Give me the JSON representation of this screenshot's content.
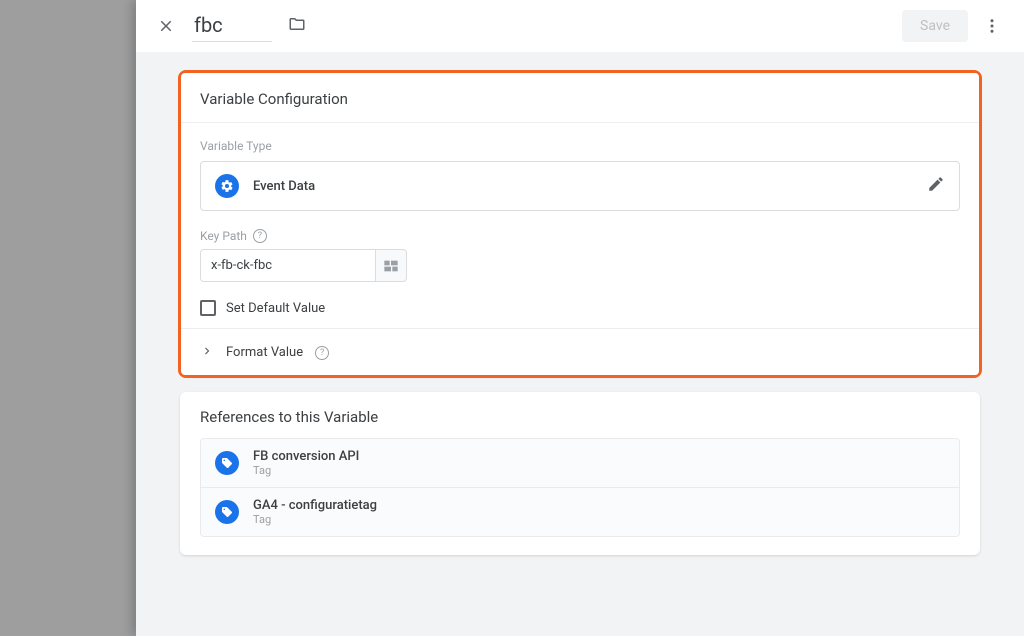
{
  "header": {
    "name": "fbc",
    "save_label": "Save"
  },
  "config": {
    "title": "Variable Configuration",
    "type_label": "Variable Type",
    "type_name": "Event Data",
    "keypath_label": "Key Path",
    "keypath_value": "x-fb-ck-fbc",
    "default_checkbox_label": "Set Default Value",
    "format_label": "Format Value"
  },
  "references": {
    "title": "References to this Variable",
    "items": [
      {
        "name": "FB conversion API",
        "kind": "Tag"
      },
      {
        "name": "GA4 - configuratietag",
        "kind": "Tag"
      }
    ]
  }
}
